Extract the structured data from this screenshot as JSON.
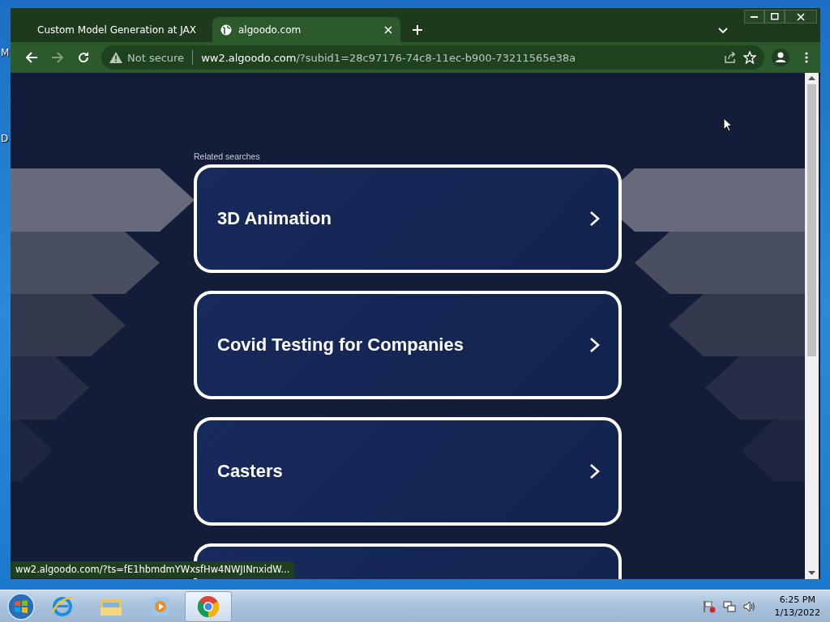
{
  "desktop": {
    "icon_labels": [
      "M",
      "D"
    ]
  },
  "browser": {
    "tabs": [
      {
        "title": "Custom Model Generation at JAX",
        "selected": false
      },
      {
        "title": "algoodo.com",
        "selected": true
      }
    ],
    "address_bar": {
      "security": "Not secure",
      "url_host": "ww2.algoodo.com",
      "url_path": "/?subid1=28c97176-74c8-11ec-b900-73211565e38a"
    },
    "page": {
      "heading": "Related searches",
      "results": [
        {
          "kind": "card",
          "label": "3D Animation"
        },
        {
          "kind": "card",
          "label": "Covid Testing for Companies"
        },
        {
          "kind": "card",
          "label": "Casters"
        },
        {
          "kind": "cut"
        }
      ]
    },
    "status_url": "ww2.algoodo.com/?ts=fE1hbmdmYWxsfHw4NWJINnxidW..."
  },
  "taskbar": {
    "apps": [
      {
        "kind": "browser-e",
        "selected": false
      },
      {
        "kind": "folder",
        "selected": false
      },
      {
        "kind": "media",
        "selected": false
      },
      {
        "kind": "chrome",
        "selected": true
      }
    ],
    "clock": {
      "time": "6:25 PM",
      "date": "1/13/2022"
    }
  }
}
